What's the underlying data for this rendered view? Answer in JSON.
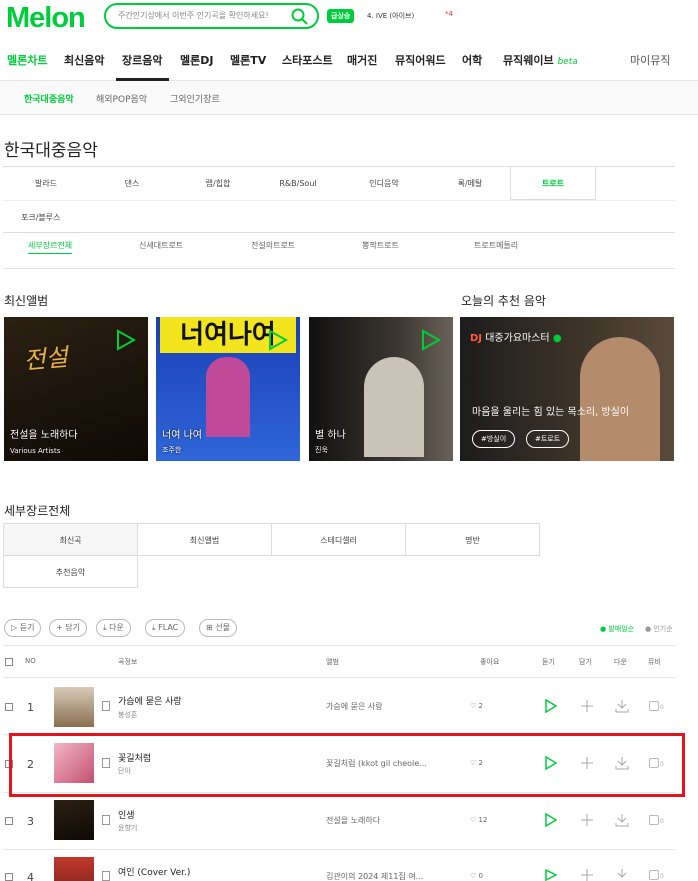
{
  "header": {
    "logo": "Melon",
    "search_placeholder": "주간인기상에서 이번주 인기곡을 확인하세요!",
    "badge": "급상승",
    "realtime_rank": "4. IVE (아이브)",
    "alert": "4"
  },
  "nav": [
    "멜론차트",
    "최신음악",
    "장르음악",
    "멜론DJ",
    "멜론TV",
    "스타포스트",
    "매거진",
    "뮤직어워드",
    "어학",
    "뮤직웨이브"
  ],
  "nav_beta": "beta",
  "nav_my": "마이뮤직",
  "subnav": [
    "한국대중음악",
    "해외POP음악",
    "그외인기장르"
  ],
  "page_title": "한국대중음악",
  "genres": [
    "발라드",
    "댄스",
    "랩/힙합",
    "R&B/Soul",
    "인디음악",
    "록/메탈",
    "트로트",
    "포크/블루스"
  ],
  "subgenres": [
    "세부장르전체",
    "신세대트로트",
    "전설의트로트",
    "뽕짝트로트",
    "트로트메들리"
  ],
  "latest_album_title": "최신앨범",
  "albums": [
    {
      "title": "전설을 노래하다",
      "artist": "Various Artists"
    },
    {
      "title": "너여 나여",
      "artist": "조주한"
    },
    {
      "title": "별 하나",
      "artist": "진욱"
    }
  ],
  "recommend": {
    "section": "오늘의 추천 음악",
    "dj": "DJ",
    "name": "대중가요마스터",
    "desc": "마음을 울리는 힘 있는 목소리, 방실이",
    "tags": [
      "#방실이",
      "#트로트"
    ]
  },
  "list_title": "세부장르전체",
  "tabs": [
    "최신곡",
    "최신앨범",
    "스테디셀러",
    "명반",
    "추천음악"
  ],
  "buttons": [
    "듣기",
    "담기",
    "다운",
    "FLAC",
    "선물"
  ],
  "sort": {
    "active": "발매일순",
    "other": "인기순"
  },
  "table_headers": [
    "NO",
    "곡정보",
    "앨범",
    "좋아요",
    "듣기",
    "담기",
    "다운",
    "뮤비"
  ],
  "songs": [
    {
      "no": "1",
      "title": "가슴에 묻은 사랑",
      "artist": "봉성훈",
      "album": "가슴에 묻은 사랑",
      "likes": "2",
      "mv": "0"
    },
    {
      "no": "2",
      "title": "꽃길처럼",
      "artist": "단아",
      "album": "꽃길처럼 (kkot gil cheole...",
      "likes": "2",
      "mv": "0"
    },
    {
      "no": "3",
      "title": "인생",
      "artist": "윤향기",
      "album": "전설을 노래하다",
      "likes": "12",
      "mv": "0"
    },
    {
      "no": "4",
      "title": "여인 (Cover Ver.)",
      "artist": "",
      "album": "김관이의 2024 제11집 여...",
      "likes": "0",
      "mv": "0"
    }
  ],
  "colors": {
    "accent": "#00cd3c",
    "highlight": "#e3141b"
  }
}
